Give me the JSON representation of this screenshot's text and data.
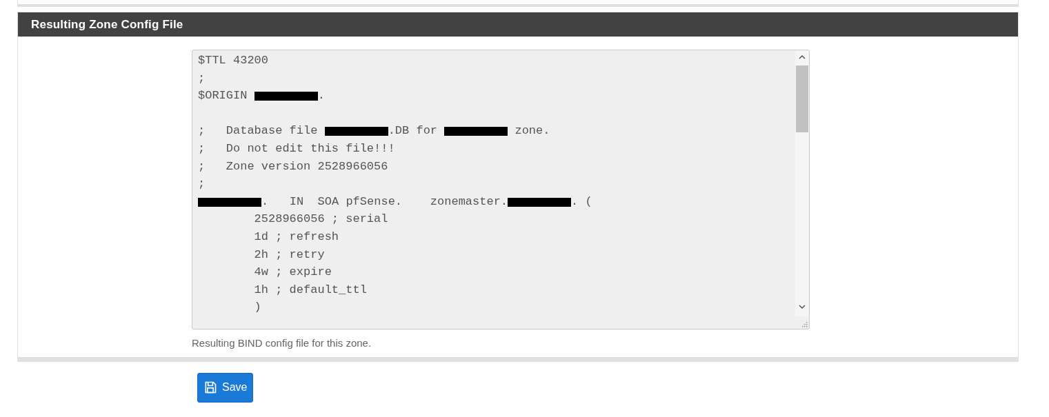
{
  "panel": {
    "title": "Resulting Zone Config File",
    "config_file": {
      "lines": [
        {
          "kind": "code",
          "segments": [
            {
              "kind": "text",
              "text": "$TTL 43200"
            }
          ]
        },
        {
          "kind": "code",
          "segments": [
            {
              "kind": "text",
              "text": ";"
            }
          ]
        },
        {
          "kind": "code",
          "segments": [
            {
              "kind": "text",
              "text": "$ORIGIN "
            },
            {
              "kind": "redaction"
            },
            {
              "kind": "text",
              "text": "."
            }
          ]
        },
        {
          "kind": "blank"
        },
        {
          "kind": "code",
          "segments": [
            {
              "kind": "text",
              "text": ";   Database file "
            },
            {
              "kind": "redaction"
            },
            {
              "kind": "text",
              "text": ".DB for "
            },
            {
              "kind": "redaction"
            },
            {
              "kind": "text",
              "text": " zone."
            }
          ]
        },
        {
          "kind": "code",
          "segments": [
            {
              "kind": "text",
              "text": ";   Do not edit this file!!!"
            }
          ]
        },
        {
          "kind": "code",
          "segments": [
            {
              "kind": "text",
              "text": ";   Zone version 2528966056"
            }
          ]
        },
        {
          "kind": "code",
          "segments": [
            {
              "kind": "text",
              "text": ";"
            }
          ]
        },
        {
          "kind": "code",
          "segments": [
            {
              "kind": "redaction"
            },
            {
              "kind": "text",
              "text": ".   IN  SOA pfSense.    zonemaster."
            },
            {
              "kind": "redaction"
            },
            {
              "kind": "text",
              "text": ". ("
            }
          ]
        },
        {
          "kind": "code",
          "segments": [
            {
              "kind": "text",
              "text": "        2528966056 ; serial"
            }
          ]
        },
        {
          "kind": "code",
          "segments": [
            {
              "kind": "text",
              "text": "        1d ; refresh"
            }
          ]
        },
        {
          "kind": "code",
          "segments": [
            {
              "kind": "text",
              "text": "        2h ; retry"
            }
          ]
        },
        {
          "kind": "code",
          "segments": [
            {
              "kind": "text",
              "text": "        4w ; expire"
            }
          ]
        },
        {
          "kind": "code",
          "segments": [
            {
              "kind": "text",
              "text": "        1h ; default_ttl"
            }
          ]
        },
        {
          "kind": "code",
          "segments": [
            {
              "kind": "text",
              "text": "        )"
            }
          ]
        }
      ]
    },
    "help_text": "Resulting BIND config file for this zone."
  },
  "save_button": {
    "label": "Save"
  }
}
